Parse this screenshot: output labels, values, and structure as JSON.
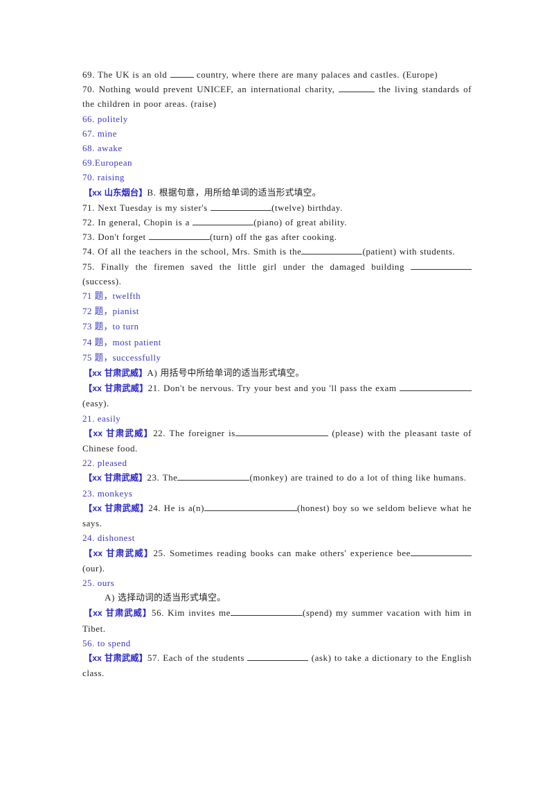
{
  "document": {
    "type": "english-grammar-worksheet-answers",
    "ink_black": "#1f1f1f",
    "ink_blue": "#3b39c4",
    "tag_blue": "#2a27c8",
    "page_background": "#ffffff"
  },
  "blocks": [
    {
      "id": "q69",
      "kind": "question",
      "text_parts": [
        "69. The UK is an old ",
        " country, where there are many palaces and castles. (Europe)"
      ],
      "blank": "b-xs",
      "full_text": "69. The UK is an old ____ country, where there are many palaces and castles. (Europe)"
    },
    {
      "id": "q70",
      "kind": "question",
      "text_parts": [
        "70. Nothing would prevent UNICEF, an international charity, ",
        " the living standards of the children in poor areas. (raise)"
      ],
      "blank": "b-sm",
      "full_text": "70. Nothing would prevent UNICEF, an international charity, _____ the living standards of the children in poor areas. (raise)"
    },
    {
      "id": "a66",
      "kind": "answer",
      "text": "66. politely"
    },
    {
      "id": "a67",
      "kind": "answer",
      "text": "67. mine"
    },
    {
      "id": "a68",
      "kind": "answer",
      "text": "68. awake"
    },
    {
      "id": "a69",
      "kind": "answer",
      "text": "69.European"
    },
    {
      "id": "a70",
      "kind": "answer",
      "text": "70. raising"
    },
    {
      "id": "hdr-shandong",
      "kind": "heading",
      "tag": "【xx 山东烟台】",
      "tag_latin": "【xx ",
      "tag_cjk": "山东烟台",
      "tag_close": "】",
      "body_latin": "B. ",
      "body_cjk": "根据句意，用所给单词的适当形式填空。"
    },
    {
      "id": "q71",
      "kind": "question",
      "text_parts": [
        "71. Next Tuesday is my sister's ",
        "(twelve) birthday."
      ],
      "blank": "b-lg",
      "full_text": "71. Next Tuesday is my sister's __________(twelve) birthday."
    },
    {
      "id": "q72",
      "kind": "question",
      "text_parts": [
        "72. In general, Chopin is a ",
        "(piano) of great ability."
      ],
      "blank": "b-lg",
      "full_text": "72. In general, Chopin is a __________(piano) of great ability."
    },
    {
      "id": "q73",
      "kind": "question",
      "text_parts": [
        "73. Don't forget ",
        "(turn) off the gas after cooking."
      ],
      "blank": "b-lg",
      "full_text": "73. Don't forget __________(turn) off the gas after cooking."
    },
    {
      "id": "q74",
      "kind": "question",
      "text_parts": [
        "74. Of all the teachers in the school, Mrs. Smith is the",
        "(patient) with students."
      ],
      "blank": "b-lg",
      "full_text": "74. Of all the teachers in the school, Mrs. Smith is the__________(patient) with students."
    },
    {
      "id": "q75",
      "kind": "question",
      "text_parts": [
        "75. Finally the firemen saved the little girl under the damaged building ",
        "(success)."
      ],
      "blank": "b-lg",
      "full_text": "75. Finally the firemen saved the little girl under the damaged building __________(success)."
    },
    {
      "id": "a71",
      "kind": "answer-cjk",
      "num": "71 ",
      "cjk": "题，",
      "word": "twelfth"
    },
    {
      "id": "a72",
      "kind": "answer-cjk",
      "num": "72 ",
      "cjk": "题，",
      "word": "pianist"
    },
    {
      "id": "a73",
      "kind": "answer-cjk",
      "num": "73 ",
      "cjk": "题，",
      "word": "to turn"
    },
    {
      "id": "a74",
      "kind": "answer-cjk",
      "num": "74 ",
      "cjk": "题，",
      "word": "most patient"
    },
    {
      "id": "a75",
      "kind": "answer-cjk",
      "num": "75 ",
      "cjk": "题，",
      "word": "successfully"
    },
    {
      "id": "hdr-gansu-a",
      "kind": "heading",
      "tag_latin": "【xx ",
      "tag_cjk": "甘肃武威",
      "tag_close": "】",
      "body_latin": "A) ",
      "body_cjk": "用括号中所给单词的适当形式填空。"
    },
    {
      "id": "q21",
      "kind": "tagged-question",
      "tag_latin": "【xx ",
      "tag_cjk": "甘肃武威",
      "tag_close": "】",
      "pre": "21. Don't be nervous. Try your best and you 'll pass the exam ",
      "post": " (easy).",
      "blank": "b-xl",
      "full_text": "21. Don't be nervous. Try your best and you 'll pass the exam __________ (easy)."
    },
    {
      "id": "a21",
      "kind": "answer",
      "text": "21. easily"
    },
    {
      "id": "q22",
      "kind": "tagged-question",
      "tag_latin": "【xx ",
      "tag_cjk": "甘肃武威",
      "tag_close": "】",
      "pre": "22. The foreigner is",
      "post": " (please) with the pleasant taste of Chinese food.",
      "blank": "b-xxl",
      "full_text": "22. The foreigner is______________ (please) with the pleasant taste of Chinese food."
    },
    {
      "id": "a22",
      "kind": "answer",
      "text": "22. pleased"
    },
    {
      "id": "q23",
      "kind": "tagged-question",
      "tag_latin": "【xx ",
      "tag_cjk": "甘肃武威",
      "tag_close": "】",
      "pre": "23. The",
      "post": "(monkey) are trained to do a lot of thing like humans.",
      "blank": "b-xl",
      "full_text": "23. The____________(monkey) are trained to do a lot of thing like humans."
    },
    {
      "id": "a23",
      "kind": "answer",
      "text": "23. monkeys"
    },
    {
      "id": "q24",
      "kind": "tagged-question",
      "tag_latin": "【xx ",
      "tag_cjk": "甘肃武威",
      "tag_close": "】",
      "pre": "24. He is a(n)",
      "post": "(honest) boy so we seldom believe what he says.",
      "blank": "b-xxl",
      "full_text": "24. He is a(n)__________________(honest) boy so we seldom believe what he says."
    },
    {
      "id": "a24",
      "kind": "answer",
      "text": "24. dishonest"
    },
    {
      "id": "q25",
      "kind": "tagged-question",
      "tag_latin": "【xx ",
      "tag_cjk": "甘肃武威",
      "tag_close": "】",
      "pre": "25. Sometimes reading books can make others' experience bee",
      "post": " (our).",
      "blank": "b-lg",
      "full_text": "25. Sometimes reading books can make others' experience bee__________ (our)."
    },
    {
      "id": "a25",
      "kind": "answer",
      "text": "25. ours"
    },
    {
      "id": "hdr-verb",
      "kind": "subheading",
      "latin": "A) ",
      "cjk": "选择动词的适当形式填空。"
    },
    {
      "id": "q56",
      "kind": "tagged-question",
      "tag_latin": "【xx ",
      "tag_cjk": "甘肃武威",
      "tag_close": "】",
      "pre": "56. Kim invites me",
      "post": "(spend) my summer vacation with him in Tibet.",
      "blank": "b-xl",
      "full_text": "56. Kim invites me______________(spend) my summer vacation with him in Tibet."
    },
    {
      "id": "a56",
      "kind": "answer",
      "text": "56. to spend"
    },
    {
      "id": "q57",
      "kind": "tagged-question",
      "tag_latin": "【xx ",
      "tag_cjk": "甘肃武威",
      "tag_close": "】",
      "pre": "57. Each of the students ",
      "post": " (ask) to take a dictionary to the English class.",
      "blank": "b-lg",
      "full_text": "57. Each of the students __________ (ask) to take a dictionary to the English class."
    }
  ]
}
